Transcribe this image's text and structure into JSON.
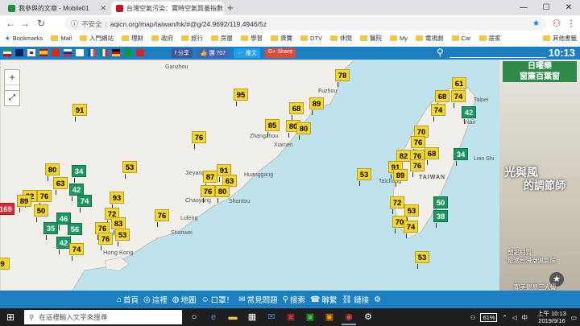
{
  "browser": {
    "tabs": [
      {
        "title": "我參與的文章 - Mobile01",
        "favicon_color": "#1f8e3d"
      },
      {
        "title": "台灣空氣污染：實時空氣質量指數",
        "favicon_color": "#c8102e"
      }
    ],
    "new_tab": "+",
    "window_controls": {
      "minimize": "—",
      "maximize": "☐",
      "close": "✕"
    },
    "address": {
      "insecure_label": "不安全",
      "separator": "|",
      "url": "aqicn.org/map/taiwan/hk/#@g/24.9692/119.4946/5z"
    },
    "bookmarks": [
      {
        "label": "Bookmarks"
      },
      {
        "label": "Mail"
      },
      {
        "label": "入門網站"
      },
      {
        "label": "理財"
      },
      {
        "label": "政府"
      },
      {
        "label": "旅行"
      },
      {
        "label": "房屋"
      },
      {
        "label": "學習"
      },
      {
        "label": "資寶"
      },
      {
        "label": "DTV"
      },
      {
        "label": "休閒"
      },
      {
        "label": "醫院"
      },
      {
        "label": "My"
      },
      {
        "label": "電視劇"
      },
      {
        "label": "Car"
      },
      {
        "label": "居家"
      },
      {
        "label": "其他書籤"
      }
    ]
  },
  "site": {
    "share_buttons": [
      {
        "label": "f 分享",
        "color": "#3b5998"
      },
      {
        "label": "👍 讚 707",
        "color": "#4267b2"
      },
      {
        "label": "🐦 推文",
        "color": "#1da1f2"
      },
      {
        "label": "G+ Share",
        "color": "#dd4b39"
      }
    ],
    "clock": "10:13",
    "zoom_in": "+",
    "zoom_out": "−",
    "fullscreen_icon": "⤢"
  },
  "map_labels": [
    {
      "text": "Ganzhou"
    },
    {
      "text": "Fuzhou"
    },
    {
      "text": "Zhangzhou"
    },
    {
      "text": "Xiamen"
    },
    {
      "text": "Huanggang"
    },
    {
      "text": "Chaoyang"
    },
    {
      "text": "Shantou"
    },
    {
      "text": "Shanwei"
    },
    {
      "text": "Lufeng"
    },
    {
      "text": "Hong Kong"
    },
    {
      "text": "Jieyang"
    },
    {
      "text": "Taichung"
    },
    {
      "text": "TAIWAN"
    },
    {
      "text": "Lian Shi"
    },
    {
      "text": "Taipei"
    },
    {
      "text": "Yilan"
    }
  ],
  "aqi_pins": [
    {
      "v": "78"
    },
    {
      "v": "91"
    },
    {
      "v": "95"
    },
    {
      "v": "68"
    },
    {
      "v": "89"
    },
    {
      "v": "85"
    },
    {
      "v": "80"
    },
    {
      "v": "80"
    },
    {
      "v": "76"
    },
    {
      "v": "61"
    },
    {
      "v": "68"
    },
    {
      "v": "74"
    },
    {
      "v": "74"
    },
    {
      "v": "42"
    },
    {
      "v": "70"
    },
    {
      "v": "76"
    },
    {
      "v": "68"
    },
    {
      "v": "82"
    },
    {
      "v": "76"
    },
    {
      "v": "34"
    },
    {
      "v": "91"
    },
    {
      "v": "89"
    },
    {
      "v": "76"
    },
    {
      "v": "53"
    },
    {
      "v": "80"
    },
    {
      "v": "34"
    },
    {
      "v": "87"
    },
    {
      "v": "91"
    },
    {
      "v": "63"
    },
    {
      "v": "76"
    },
    {
      "v": "80"
    },
    {
      "v": "53"
    },
    {
      "v": "72"
    },
    {
      "v": "50"
    },
    {
      "v": "53"
    },
    {
      "v": "38"
    },
    {
      "v": "70"
    },
    {
      "v": "74"
    },
    {
      "v": "53"
    },
    {
      "v": "63"
    },
    {
      "v": "42"
    },
    {
      "v": "82"
    },
    {
      "v": "76"
    },
    {
      "v": "89"
    },
    {
      "v": "50"
    },
    {
      "v": "74"
    },
    {
      "v": "46"
    },
    {
      "v": "93"
    },
    {
      "v": "169"
    },
    {
      "v": "76"
    },
    {
      "v": "72"
    },
    {
      "v": "83"
    },
    {
      "v": "35"
    },
    {
      "v": "56"
    },
    {
      "v": "76"
    },
    {
      "v": "42"
    },
    {
      "v": "74"
    },
    {
      "v": "9"
    },
    {
      "v": "76"
    },
    {
      "v": "53"
    }
  ],
  "ad": {
    "logo_line1": "日曜樂",
    "logo_line2": "窗簾百葉窗",
    "slogan1": "光與風",
    "slogan2": "的調節師",
    "copy1": "塑鋁材質",
    "copy2": "最適台灣潮濕氣候",
    "copy3": "即美觀易三大優"
  },
  "bottom_nav": [
    {
      "icon": "⌂",
      "label": "首頁"
    },
    {
      "icon": "◎",
      "label": "這裡"
    },
    {
      "icon": "◍",
      "label": "地圖"
    },
    {
      "icon": "☺",
      "label": "口罩！"
    },
    {
      "icon": "✉",
      "label": "常見問題"
    },
    {
      "icon": "⚲",
      "label": "搜索"
    },
    {
      "icon": "☎",
      "label": "聯繫"
    },
    {
      "icon": "⛓",
      "label": "鏈接"
    },
    {
      "icon": "⚙",
      "label": ""
    }
  ],
  "taskbar": {
    "search_placeholder": "在這裡輸入文字來搜尋",
    "battery": "61%",
    "time": "上午 10:13",
    "date": "2019/9/16"
  },
  "colors": {
    "good": "#19975f",
    "moderate": "#f4d62c",
    "unhealthy": "#e0262f",
    "brand": "#1b7fc1"
  }
}
